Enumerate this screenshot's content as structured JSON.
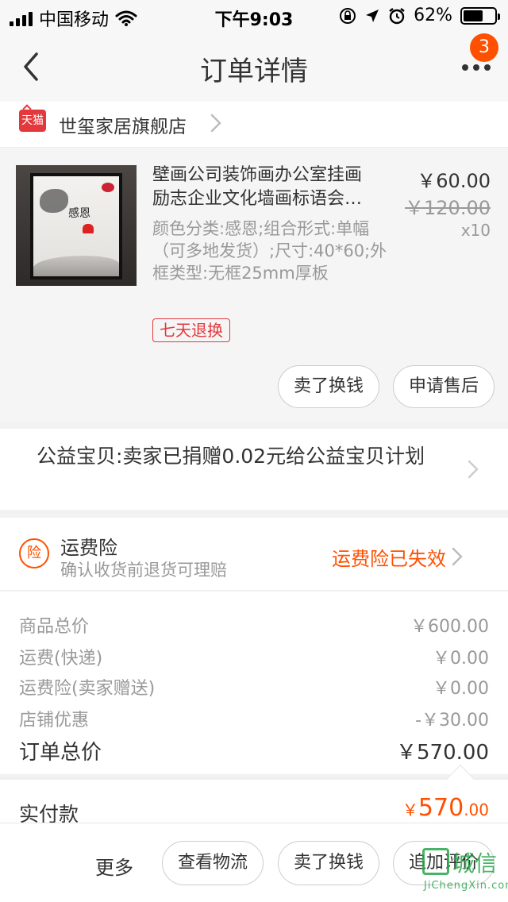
{
  "status_bar": {
    "carrier": "中国移动",
    "time": "下午9:03",
    "battery": "62%",
    "battery_level": 0.62
  },
  "nav": {
    "title": "订单详情",
    "more_badge": "3"
  },
  "store": {
    "badge": "天猫",
    "name": "世玺家居旗舰店"
  },
  "product": {
    "title_line1": "壁画公司装饰画办公室挂画",
    "title_line2": "励志企业文化墙画标语会…",
    "price": "￥60.00",
    "original_price": "￥120.00",
    "quantity": "x10",
    "sku": "颜色分类:感恩;组合形式:单幅（可多地发货）;尺寸:40*60;外框类型:无框25mm厚板",
    "thumbnail_text": "感恩",
    "service_tag": "七天退换",
    "btn_sell": "卖了换钱",
    "btn_aftersale": "申请售后"
  },
  "charity": {
    "text": "公益宝贝:卖家已捐赠0.02元给公益宝贝计划"
  },
  "insurance": {
    "icon_text": "险",
    "title": "运费险",
    "subtitle": "确认收货前退货可理赔",
    "status": "运费险已失效"
  },
  "summary": {
    "rows": [
      {
        "label": "商品总价",
        "value": "￥600.00"
      },
      {
        "label": "运费(快递)",
        "value": "￥0.00"
      },
      {
        "label": "运费险(卖家赠送)",
        "value": "￥0.00"
      },
      {
        "label": "店铺优惠",
        "value": "-￥30.00"
      }
    ],
    "total_label": "订单总价",
    "total_value": "￥570.00",
    "paid_label": "实付款",
    "paid_currency": "￥",
    "paid_int": "570",
    "paid_dec": ".00"
  },
  "bottom_bar": {
    "more": "更多",
    "track": "查看物流",
    "sell": "卖了换钱",
    "review": "追加评价"
  },
  "watermark": {
    "chars": "城信",
    "url": "JiChengXin.com"
  },
  "colors": {
    "accent": "#ff5000",
    "tmall_red": "#e4393c",
    "watermark_green": "#2aa64b"
  },
  "icons": [
    "signal-icon",
    "wifi-icon",
    "lock-rotation-icon",
    "location-icon",
    "alarm-icon",
    "battery-icon",
    "back-icon",
    "more-icon",
    "chevron-right-icon",
    "insurance-icon"
  ]
}
